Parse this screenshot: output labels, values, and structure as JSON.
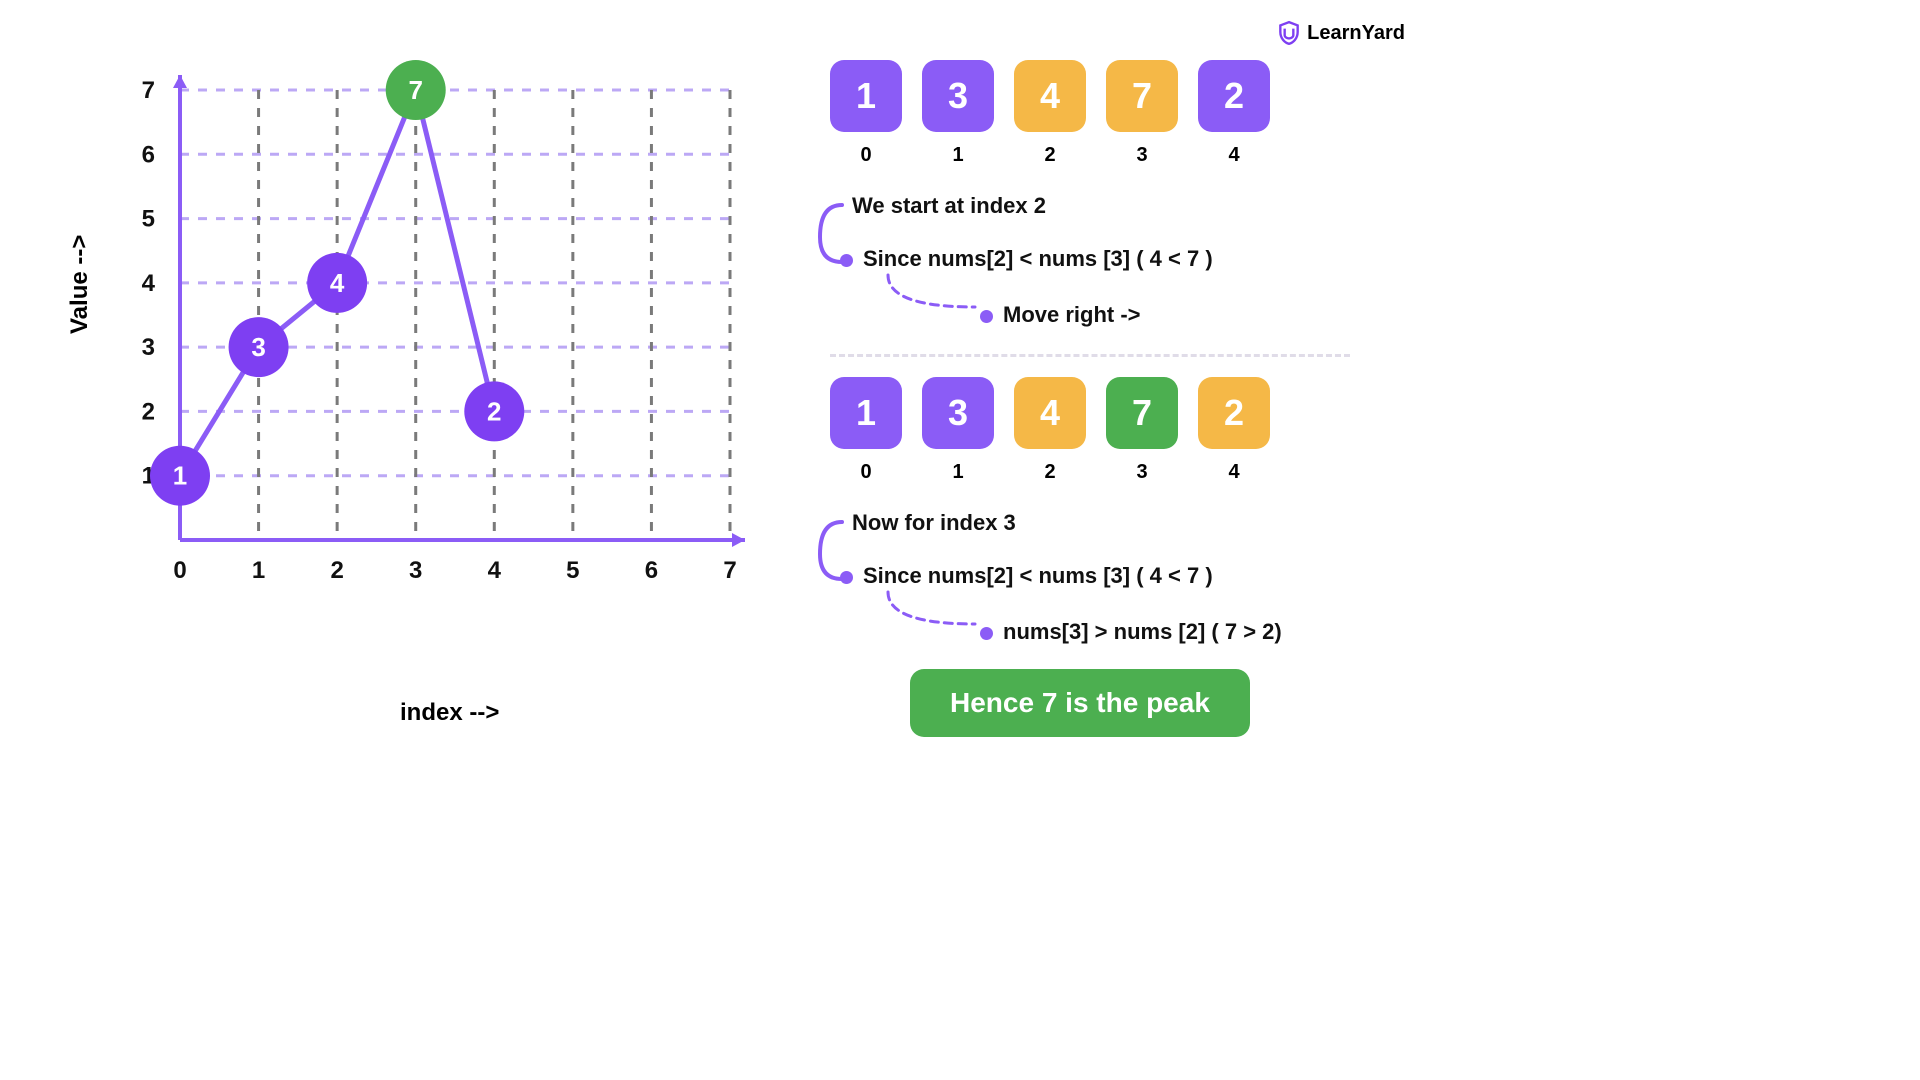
{
  "brand": {
    "name": "LearnYard"
  },
  "chart_data": {
    "type": "line",
    "xlabel": "index -->",
    "ylabel": "Value -->",
    "x": [
      0,
      1,
      2,
      3,
      4
    ],
    "values": [
      1,
      3,
      4,
      7,
      2
    ],
    "x_ticks": [
      0,
      1,
      2,
      3,
      4,
      5,
      6,
      7
    ],
    "y_ticks": [
      1,
      2,
      3,
      4,
      5,
      6,
      7
    ],
    "xlim": [
      0,
      7
    ],
    "ylim": [
      0,
      7
    ],
    "peak_index": 3,
    "peak_color": "#4caf50",
    "point_color": "#7e3ff2",
    "line_color": "#8b5cf6"
  },
  "step1": {
    "array": [
      {
        "v": "1",
        "color": "purple"
      },
      {
        "v": "3",
        "color": "purple"
      },
      {
        "v": "4",
        "color": "orange"
      },
      {
        "v": "7",
        "color": "orange"
      },
      {
        "v": "2",
        "color": "purple"
      }
    ],
    "indices": [
      "0",
      "1",
      "2",
      "3",
      "4"
    ],
    "line1": "We start at index 2",
    "line2": "Since nums[2] < nums [3] ( 4 < 7 )",
    "line3": "Move right ->"
  },
  "step2": {
    "array": [
      {
        "v": "1",
        "color": "purple"
      },
      {
        "v": "3",
        "color": "purple"
      },
      {
        "v": "4",
        "color": "orange"
      },
      {
        "v": "7",
        "color": "green"
      },
      {
        "v": "2",
        "color": "orange"
      }
    ],
    "indices": [
      "0",
      "1",
      "2",
      "3",
      "4"
    ],
    "line1": "Now for index 3",
    "line2": "Since nums[2] < nums [3] ( 4 < 7 )",
    "line3": "nums[3] > nums [2] ( 7 > 2)"
  },
  "conclusion": "Hence 7 is the peak"
}
